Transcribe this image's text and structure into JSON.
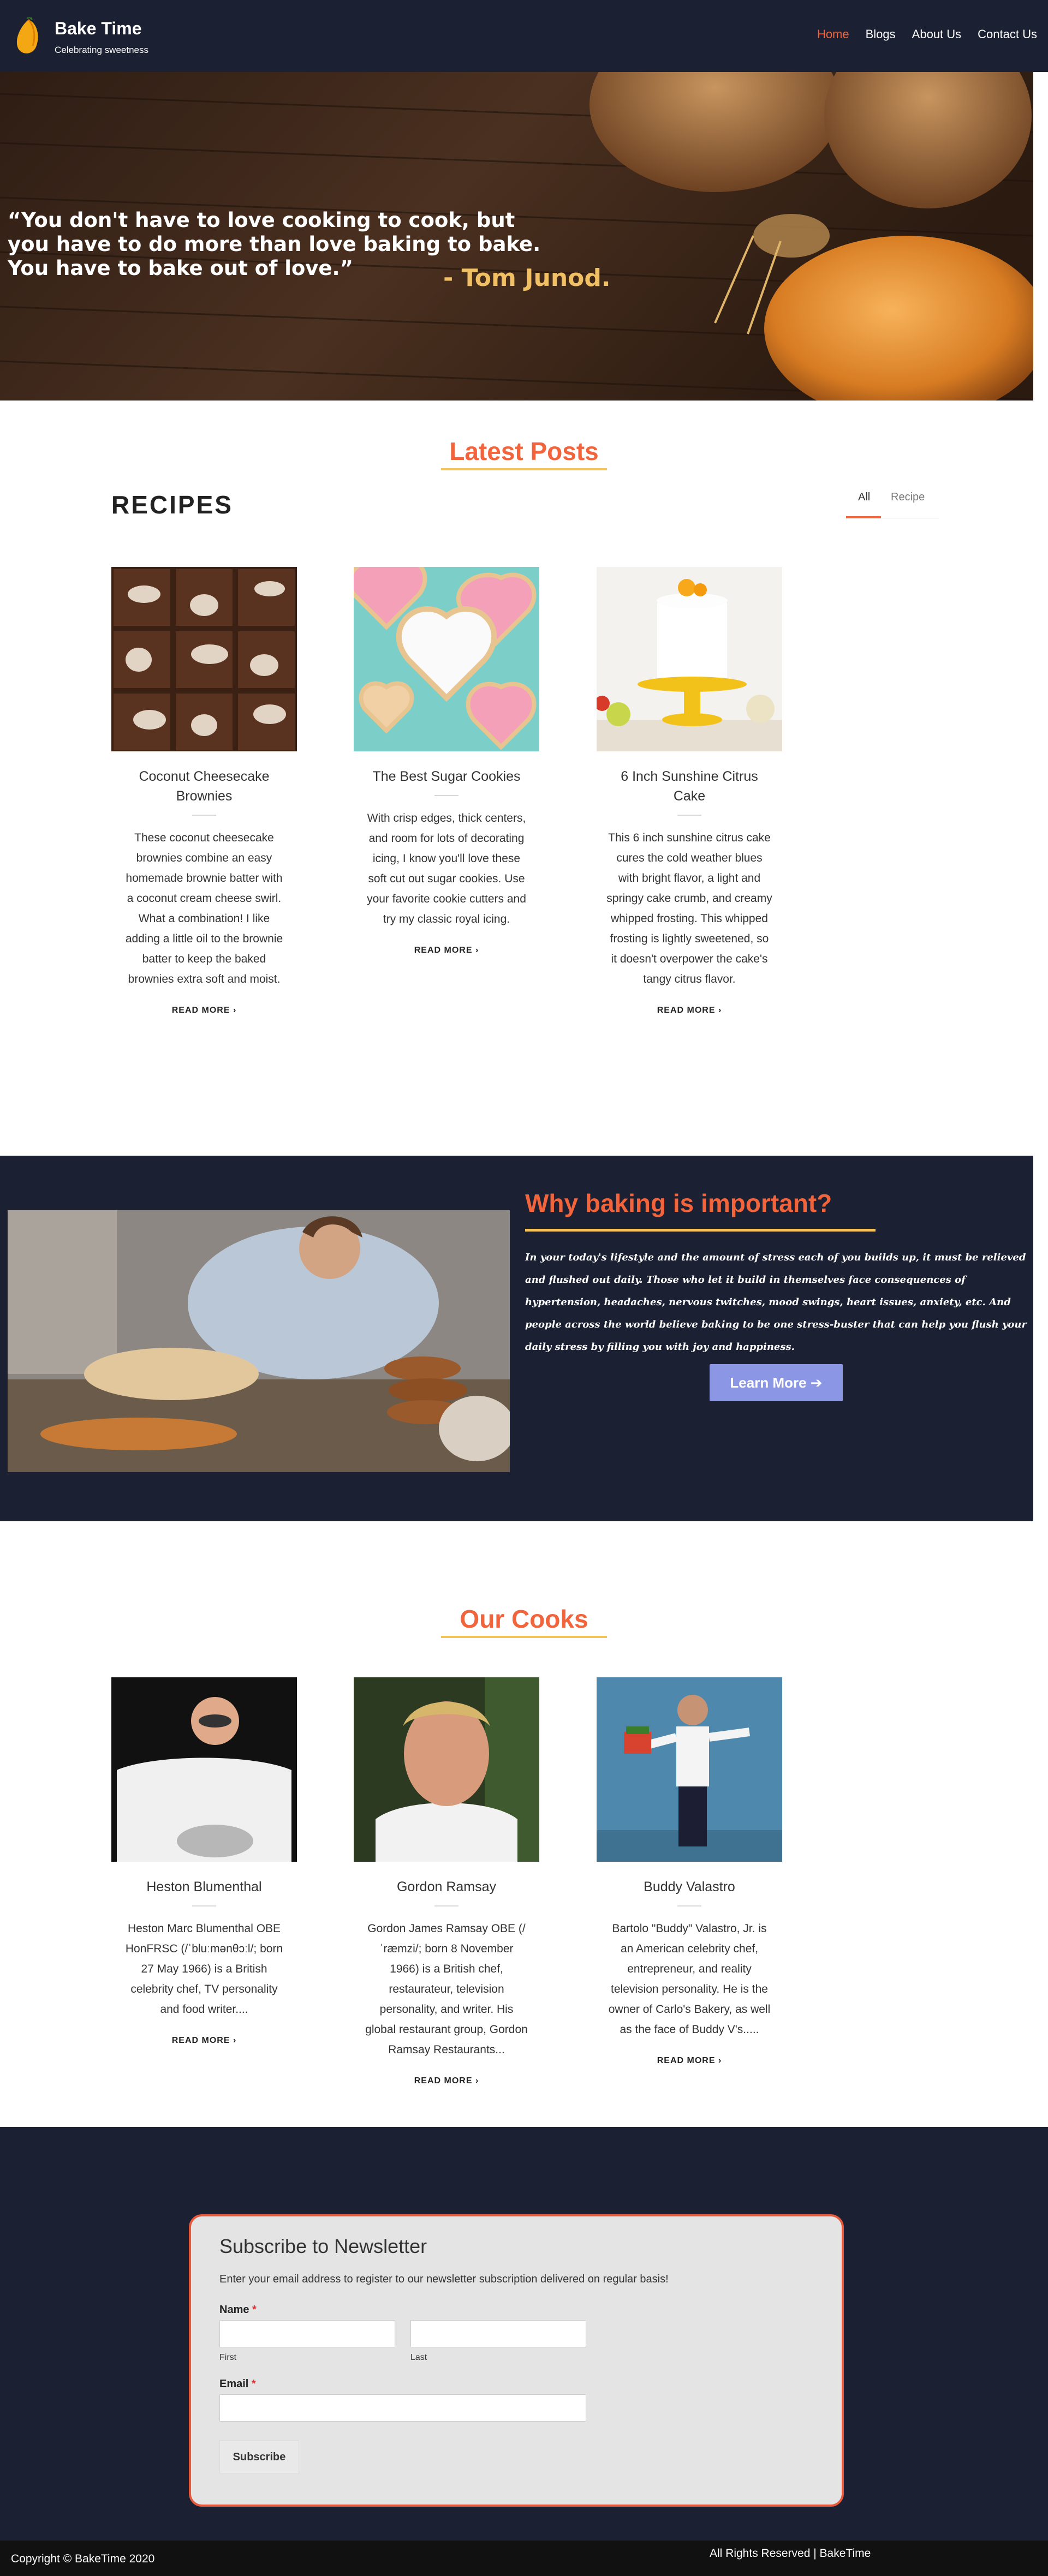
{
  "brand": {
    "title": "Bake Time",
    "subtitle": "Celebrating sweetness"
  },
  "nav": {
    "links": [
      "Home",
      "Blogs",
      "About Us",
      "Contact Us"
    ]
  },
  "hero": {
    "quote": "“You don't have to love cooking to cook, but you have to do more than love baking to bake. You have to bake out of love.”",
    "author": "- Tom Junod."
  },
  "latest": {
    "title": "Latest Posts",
    "heading": "RECIPES",
    "tabs": [
      "All",
      "Recipe"
    ]
  },
  "posts": [
    {
      "title": "Coconut Cheesecake Brownies",
      "desc": "These coconut cheesecake brownies combine an easy homemade brownie batter with a coconut cream cheese swirl. What a combination! I like adding a little oil to the brownie batter to keep the baked brownies extra soft and moist.",
      "more": "READ MORE ›"
    },
    {
      "title": "The Best Sugar Cookies",
      "desc": "With crisp edges, thick centers, and room for lots of decorating icing, I know you'll love these soft cut out sugar cookies. Use your favorite cookie cutters and try my classic royal icing.",
      "more": "READ MORE ›"
    },
    {
      "title": "6 Inch Sunshine Citrus Cake",
      "desc": "This 6 inch sunshine citrus cake cures the cold weather blues with bright flavor, a light and springy cake crumb, and creamy whipped frosting. This whipped frosting is lightly sweetened, so it doesn't overpower the cake's tangy citrus flavor.",
      "more": "READ MORE ›"
    }
  ],
  "baking": {
    "title": "Why baking is important?",
    "text": "In your today's lifestyle and the amount of stress each of you builds up, it must be relieved and flushed out daily. Those who let it build in themselves face consequences of hypertension, headaches, nervous twitches, mood swings, heart issues, anxiety, etc. And people across the world believe baking to be one stress-buster that can help you flush your daily stress by filling you with joy and happiness.",
    "button": "Learn More"
  },
  "cooks": {
    "title": "Our Cooks",
    "items": [
      {
        "name": "Heston Blumenthal",
        "desc": "Heston Marc Blumenthal OBE HonFRSC (/ˈbluːmənθɔːl/; born 27 May 1966) is a British celebrity chef, TV personality and food writer....",
        "more": "READ MORE ›"
      },
      {
        "name": "Gordon Ramsay",
        "desc": "Gordon James Ramsay OBE (/ˈræmzi/; born 8 November 1966) is a British chef, restaurateur, television personality, and writer. His global restaurant group, Gordon Ramsay Restaurants...",
        "more": "READ MORE ›"
      },
      {
        "name": "Buddy Valastro",
        "desc": "Bartolo \"Buddy\" Valastro, Jr. is an American celebrity chef, entrepreneur, and reality television personality. He is the owner of Carlo's Bakery, as well as the face of Buddy V's.....",
        "more": "READ MORE ›"
      }
    ]
  },
  "newsletter": {
    "title": "Subscribe to Newsletter",
    "desc": "Enter your email address to register to our newsletter subscription delivered on regular basis!",
    "name_label": "Name",
    "first_label": "First",
    "last_label": "Last",
    "email_label": "Email",
    "required_mark": "*",
    "button": "Subscribe"
  },
  "footer": {
    "copyright": "Copyright © BakeTime 2020",
    "rights": "All Rights Reserved | BakeTime"
  },
  "colors": {
    "navy": "#1b2033",
    "accent": "#f2643b",
    "gold": "#f4c45a",
    "button": "#8b96e4"
  }
}
